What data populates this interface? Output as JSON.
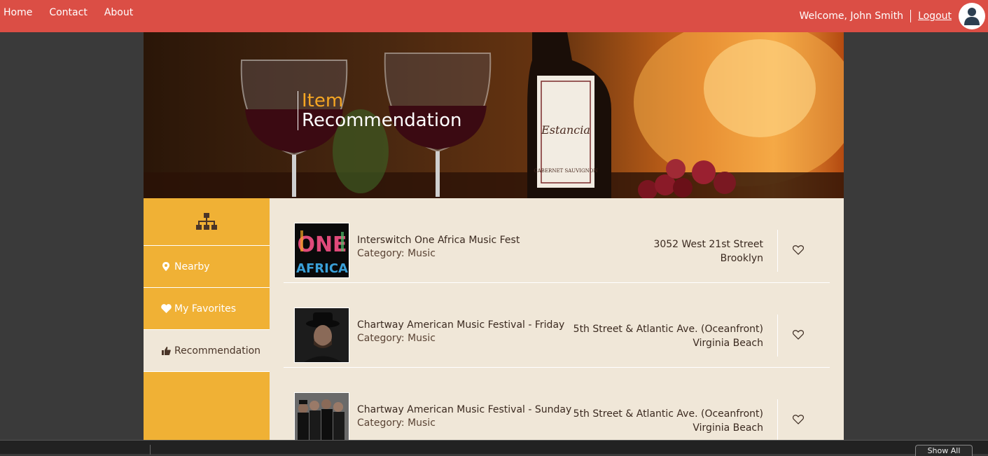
{
  "nav": {
    "links": [
      "Home",
      "Contact",
      "About"
    ],
    "welcome": "Welcome, John Smith",
    "logout": "Logout"
  },
  "hero": {
    "title_line1": "Item",
    "title_line2": "Recommendation"
  },
  "sidebar": {
    "items": [
      {
        "label": "Nearby",
        "icon": "map-pin-icon"
      },
      {
        "label": "My Favorites",
        "icon": "heart-icon"
      },
      {
        "label": "Recommendation",
        "icon": "thumbs-up-icon",
        "active": true
      }
    ]
  },
  "items": [
    {
      "title": "Interswitch One Africa Music Fest",
      "category": "Category: Music",
      "address_line1": "3052 West 21st Street",
      "address_line2": "Brooklyn"
    },
    {
      "title": "Chartway American Music Festival - Friday",
      "category": "Category: Music",
      "address_line1": "5th Street & Atlantic Ave. (Oceanfront)",
      "address_line2": "Virginia Beach"
    },
    {
      "title": "Chartway American Music Festival - Sunday",
      "category": "Category: Music",
      "address_line1": "5th Street & Atlantic Ave. (Oceanfront)",
      "address_line2": "Virginia Beach"
    }
  ],
  "bottom": {
    "show_all": "Show All"
  },
  "colors": {
    "nav_bg": "#db4e45",
    "sidebar_bg": "#f0b135",
    "content_bg": "#f0e7d8",
    "accent_orange": "#f5a623"
  }
}
